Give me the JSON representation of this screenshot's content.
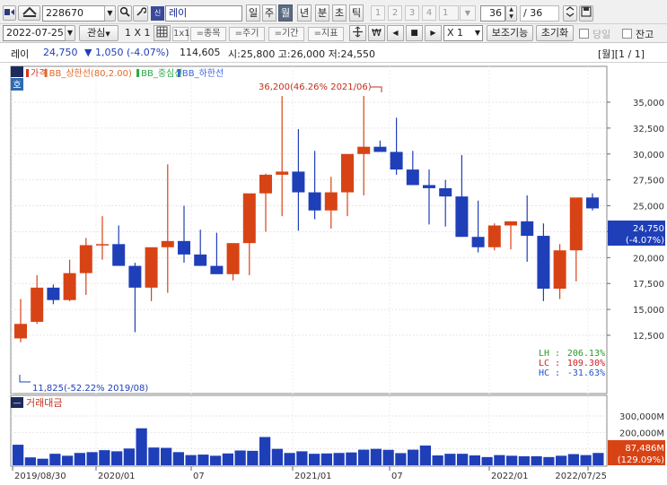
{
  "toolbar": {
    "stock_code": "228670",
    "stock_name": "레이",
    "periods": [
      "일",
      "주",
      "월",
      "년",
      "분",
      "초",
      "틱"
    ],
    "active_period": "월",
    "numbers": [
      "1",
      "2",
      "3",
      "4",
      "1"
    ],
    "count_value": "36",
    "count_total": "/ 36"
  },
  "toolbar2": {
    "date": "2022-07-25",
    "watch": "관심",
    "layout": "1 X 1",
    "sym_1x1": "1x1",
    "stock_btn": "=종목",
    "period_btn": "=주기",
    "range_btn": "=기간",
    "indicator_btn": "=지표",
    "won": "₩",
    "zoom": "X 1",
    "aux_btn": "보조기능",
    "reset_btn": "초기화",
    "cb1": "당일",
    "cb2": "잔고"
  },
  "infobar": {
    "name": "레이",
    "price": "24,750",
    "change": "▼ 1,050 (-4.07%)",
    "volume": "114,605",
    "ohl": "시:25,800 고:26,000 저:24,550",
    "paging": "[월][1 / 1]"
  },
  "price_panel": {
    "badge": "호",
    "legend": [
      {
        "name": "가격",
        "color": "#e0301e"
      },
      {
        "name": "BB_상한선(80,2.00)",
        "color": "#e06a2a"
      },
      {
        "name": "BB_중심선",
        "color": "#2aa844"
      },
      {
        "name": "BB_하한선",
        "color": "#3a66d8"
      }
    ],
    "high_label": "36,200(46.26% 2021/06)",
    "low_label": "11,825(-52.22% 2019/08)",
    "y_ticks": [
      "35,000",
      "32,500",
      "30,000",
      "27,500",
      "25,000",
      "22,500",
      "20,000",
      "17,500",
      "15,000",
      "12,500"
    ],
    "last_price": "24,750",
    "last_change": "(-4.07%)",
    "stats": [
      {
        "label": "LH",
        "value": "206.13%",
        "color": "#2b9a2b"
      },
      {
        "label": "LC",
        "value": "109.30%",
        "color": "#d02020"
      },
      {
        "label": "HC",
        "value": "-31.63%",
        "color": "#2255cc"
      }
    ]
  },
  "volume_panel": {
    "badge": "—",
    "legend": "거래대금",
    "y_ticks": [
      "300,000M",
      "200,000M",
      "100,000M"
    ],
    "last_value": "87,486M",
    "last_pct": "(129.09%)"
  },
  "x_axis": {
    "labels": [
      "2019/08/30",
      "2020/01",
      "07",
      "2021/01",
      "07",
      "2022/01",
      "2022/07/25"
    ]
  },
  "colors": {
    "up": "#d84315",
    "down": "#1f3fb8",
    "vol": "#1f3fb8"
  },
  "chart_data": {
    "type": "candlestick",
    "x": [
      "2019/08",
      "2019/09",
      "2019/10",
      "2019/11",
      "2019/12",
      "2020/01",
      "2020/02",
      "2020/03",
      "2020/04",
      "2020/05",
      "2020/06",
      "2020/07",
      "2020/08",
      "2020/09",
      "2020/10",
      "2020/11",
      "2020/12",
      "2021/01",
      "2021/02",
      "2021/03",
      "2021/04",
      "2021/05",
      "2021/06",
      "2021/07",
      "2021/08",
      "2021/09",
      "2021/10",
      "2021/11",
      "2021/12",
      "2022/01",
      "2022/02",
      "2022/03",
      "2022/04",
      "2022/05",
      "2022/06",
      "2022/07"
    ],
    "open": [
      12200,
      13800,
      17100,
      15900,
      18500,
      21200,
      21300,
      19200,
      17100,
      21000,
      21600,
      20300,
      19200,
      18400,
      21400,
      26200,
      28000,
      28300,
      26300,
      24550,
      26300,
      30000,
      30700,
      30200,
      28500,
      27000,
      26700,
      25900,
      22000,
      21000,
      23100,
      23500,
      22100,
      17000,
      20700,
      25800
    ],
    "high": [
      16000,
      18300,
      17400,
      19800,
      21900,
      24000,
      23100,
      19500,
      18500,
      29000,
      25000,
      22700,
      22400,
      20500,
      25000,
      28100,
      35600,
      32400,
      30300,
      27800,
      26600,
      35600,
      31300,
      33500,
      30300,
      28500,
      27500,
      29900,
      25500,
      23300,
      23500,
      26000,
      23300,
      21300,
      22600,
      26200
    ],
    "low": [
      11825,
      13600,
      15500,
      15800,
      16400,
      19800,
      19600,
      12800,
      15800,
      16600,
      19500,
      19200,
      18900,
      17800,
      18300,
      22500,
      24000,
      22600,
      23700,
      22800,
      24000,
      26000,
      30200,
      28000,
      27000,
      23200,
      23000,
      22000,
      20500,
      20700,
      20800,
      19600,
      15800,
      16000,
      17700,
      24550
    ],
    "close": [
      13600,
      17100,
      15900,
      18500,
      21200,
      21300,
      19200,
      17100,
      21000,
      21600,
      20300,
      19200,
      18400,
      21400,
      26200,
      28000,
      28300,
      26300,
      24550,
      26300,
      30000,
      30700,
      30200,
      28500,
      27000,
      26700,
      25900,
      22000,
      21000,
      23100,
      23500,
      22100,
      17000,
      20700,
      25800,
      24750
    ],
    "volume_M": [
      125000,
      48000,
      40000,
      70000,
      58000,
      75000,
      80000,
      92000,
      85000,
      102000,
      225000,
      108000,
      106000,
      80000,
      62000,
      65000,
      58000,
      72000,
      90000,
      88000,
      172000,
      100000,
      75000,
      85000,
      70000,
      72000,
      75000,
      78000,
      95000,
      100000,
      94000,
      74000,
      95000,
      120000,
      60000,
      70000,
      70000,
      60000,
      50000,
      62000,
      58000,
      55000,
      55000,
      50000,
      58000,
      68000,
      62000,
      75000
    ]
  }
}
